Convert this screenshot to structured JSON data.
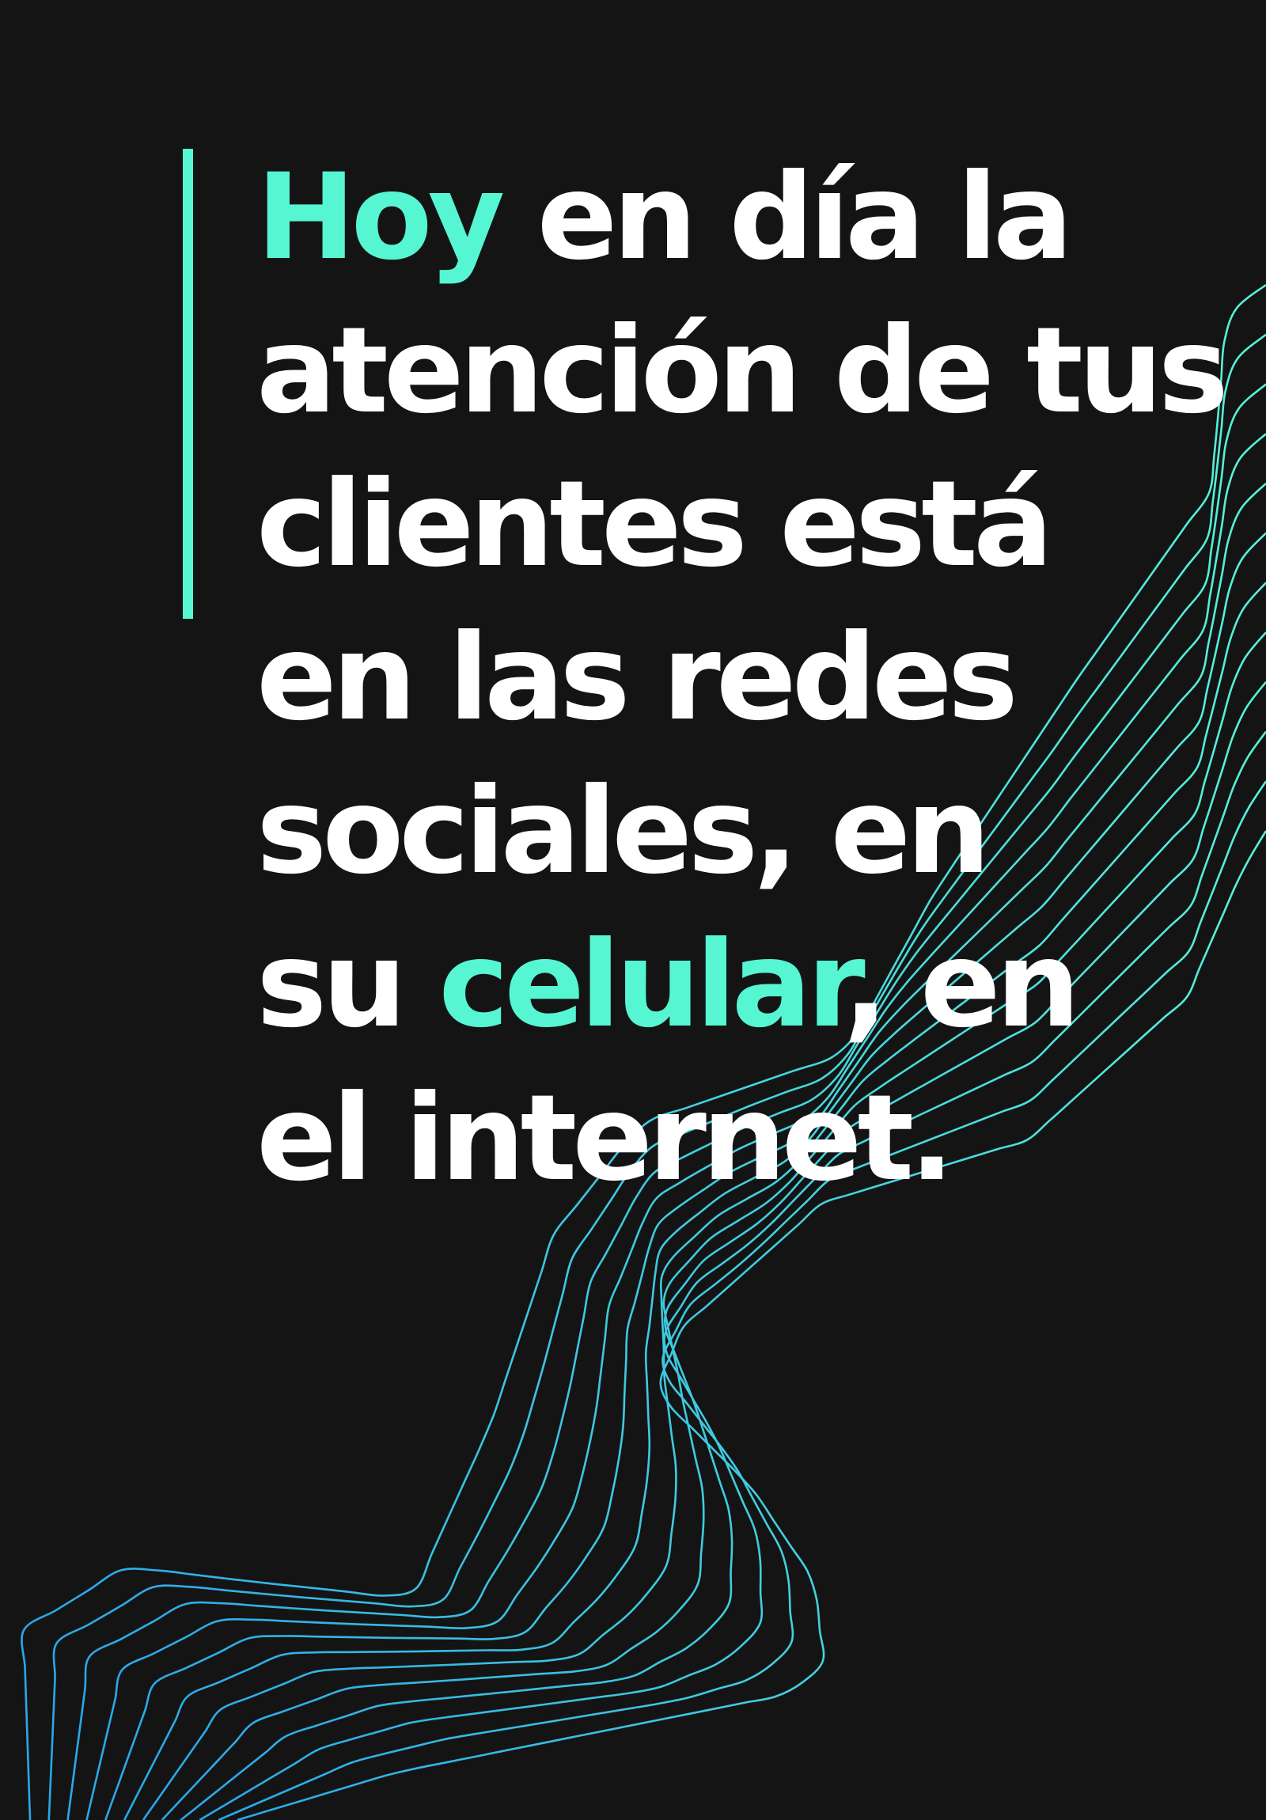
{
  "colors": {
    "background": "#141414",
    "text": "#ffffff",
    "accent": "#56f6d3",
    "wave_start": "#2aa7e8",
    "wave_end": "#56f2d8"
  },
  "headline": {
    "lines": [
      {
        "parts": [
          {
            "text": "Hoy",
            "highlight": true
          },
          {
            "text": " en día la",
            "highlight": false
          }
        ]
      },
      {
        "parts": [
          {
            "text": "atención de tus",
            "highlight": false
          }
        ]
      },
      {
        "parts": [
          {
            "text": "clientes está",
            "highlight": false
          }
        ]
      },
      {
        "parts": [
          {
            "text": "en las redes",
            "highlight": false
          }
        ]
      },
      {
        "parts": [
          {
            "text": "sociales, en",
            "highlight": false
          }
        ]
      },
      {
        "parts": [
          {
            "text": "su ",
            "highlight": false
          },
          {
            "text": "celular",
            "highlight": true
          },
          {
            "text": ", en",
            "highlight": false
          }
        ]
      },
      {
        "parts": [
          {
            "text": "el internet.",
            "highlight": false
          }
        ]
      }
    ]
  },
  "decoration": {
    "wave_line_count": 12
  }
}
